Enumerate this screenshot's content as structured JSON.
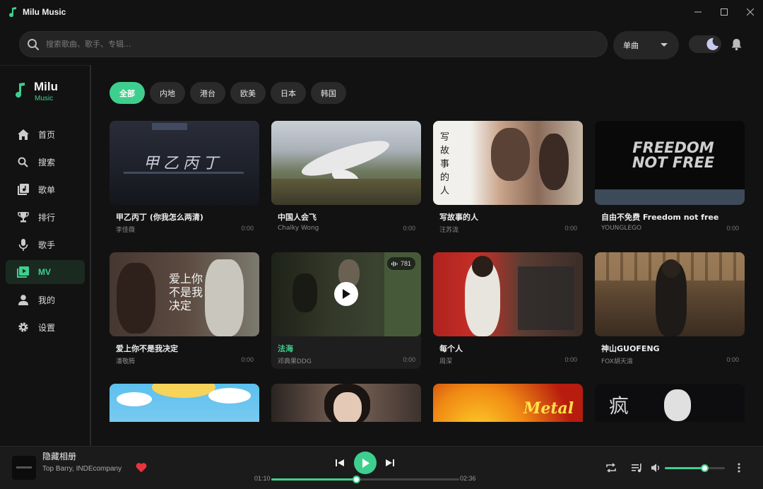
{
  "window": {
    "title": "Milu Music",
    "controls": [
      "minimize",
      "maximize",
      "close"
    ]
  },
  "search": {
    "placeholder": "搜索歌曲、歌手、专辑...",
    "value": "",
    "type_selected": "单曲"
  },
  "theme_toggle": {
    "mode": "dark",
    "icon": "moon-icon"
  },
  "notifications": {
    "icon": "bell-icon"
  },
  "brand": {
    "name": "Milu",
    "sub": "Music"
  },
  "sidebar": {
    "items": [
      {
        "label": "首页",
        "icon": "home-icon",
        "active": false
      },
      {
        "label": "搜索",
        "icon": "search-icon",
        "active": false
      },
      {
        "label": "歌单",
        "icon": "playlist-icon",
        "active": false
      },
      {
        "label": "排行",
        "icon": "trophy-icon",
        "active": false
      },
      {
        "label": "歌手",
        "icon": "microphone-icon",
        "active": false
      },
      {
        "label": "MV",
        "icon": "video-icon",
        "active": true
      },
      {
        "label": "我的",
        "icon": "user-icon",
        "active": false
      },
      {
        "label": "设置",
        "icon": "gear-icon",
        "active": false
      }
    ]
  },
  "filters": {
    "chips": [
      "全部",
      "内地",
      "港台",
      "欧美",
      "日本",
      "韩国"
    ],
    "active": "全部"
  },
  "mvs": [
    {
      "title": "甲乙丙丁 (你我怎么两清)",
      "artist": "李佳薇",
      "duration": "0:00",
      "thumb_text": "甲乙丙丁"
    },
    {
      "title": "中国人会飞",
      "artist": "Chalky Wong",
      "duration": "0:00",
      "thumb_text": ""
    },
    {
      "title": "写故事的人",
      "artist": "汪苏泷",
      "duration": "0:00",
      "thumb_text": "写故事的人"
    },
    {
      "title": "自由不免费 Freedom not free",
      "artist": "YOUNGLEGO",
      "duration": "0:00",
      "thumb_text": "FREEDOM NOT FREE"
    },
    {
      "title": "爱上你不是我决定",
      "artist": "潘敬腾",
      "duration": "0:00",
      "thumb_text": "爱上你不是我决定"
    },
    {
      "title": "法海",
      "artist": "邓典果DDG",
      "duration": "0:00",
      "views": "781",
      "hover": true
    },
    {
      "title": "每个人",
      "artist": "周深",
      "duration": "0:00",
      "thumb_text": ""
    },
    {
      "title": "神山GUOFENG",
      "artist": "FOX胡天渝",
      "duration": "0:00",
      "thumb_text": ""
    },
    {
      "title": "",
      "artist": "",
      "duration": "",
      "thumb_text": ""
    },
    {
      "title": "",
      "artist": "",
      "duration": "",
      "thumb_text": ""
    },
    {
      "title": "",
      "artist": "",
      "duration": "",
      "thumb_text": "Metal"
    },
    {
      "title": "",
      "artist": "",
      "duration": "",
      "thumb_text": "疯"
    }
  ],
  "player": {
    "title": "隐藏相册",
    "artist": "Top Barry, INDEcompany",
    "liked": true,
    "current_time": "01:10",
    "total_time": "02:36",
    "progress": 0.45,
    "volume": 0.66,
    "accent": "#3ecf8e"
  }
}
